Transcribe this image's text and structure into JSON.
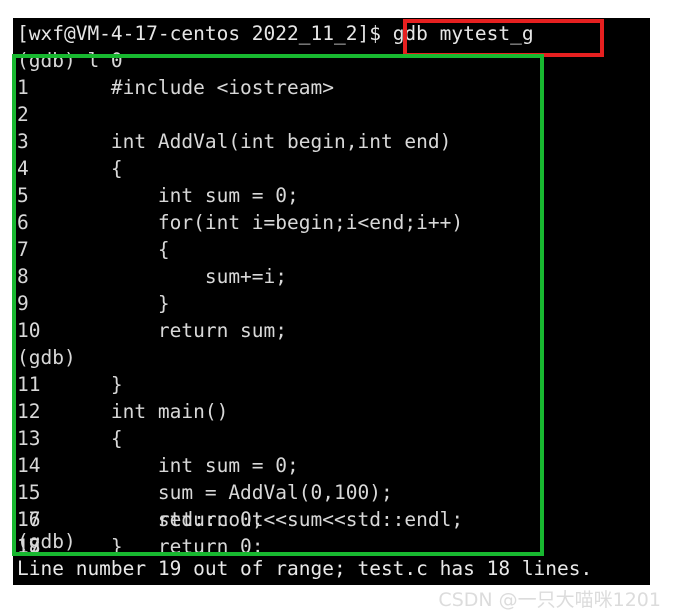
{
  "terminal": {
    "prompt": "[wxf@VM-4-17-centos 2022_11_2]$ ",
    "command": "gdb mytest_g",
    "lines": [
      {
        "kind": "gdb",
        "text": "(gdb) l 0"
      },
      {
        "kind": "code",
        "text": "1\t#include <iostream>"
      },
      {
        "kind": "code",
        "text": "2\t"
      },
      {
        "kind": "code",
        "text": "3\tint AddVal(int begin,int end)"
      },
      {
        "kind": "code",
        "text": "4\t{"
      },
      {
        "kind": "code",
        "text": "5\t    int sum = 0;"
      },
      {
        "kind": "code",
        "text": "6\t    for(int i=begin;i<end;i++)"
      },
      {
        "kind": "code",
        "text": "7\t    {"
      },
      {
        "kind": "code",
        "text": "8\t        sum+=i;"
      },
      {
        "kind": "code",
        "text": "9\t    }"
      },
      {
        "kind": "code",
        "text": "10\t    return sum;"
      },
      {
        "kind": "gdb",
        "text": "(gdb)"
      },
      {
        "kind": "code",
        "text": "11\t}"
      },
      {
        "kind": "code",
        "text": "12\tint main()"
      },
      {
        "kind": "code",
        "text": "13\t{"
      },
      {
        "kind": "code",
        "text": "14\t    int sum = 0;"
      },
      {
        "kind": "code",
        "text": "15\t    sum = AddVal(0,100);"
      },
      {
        "kind": "code",
        "text": "16\t    std::cout<<sum<<std::endl;"
      },
      {
        "kind": "code",
        "text": "17\t    return 0;"
      },
      {
        "kind": "code",
        "text": "18\t}"
      },
      {
        "kind": "gdb",
        "text": "(gdb)"
      },
      {
        "kind": "error",
        "text": "Line number 19 out of range; test.c has 18 lines."
      }
    ]
  },
  "annotations": {
    "command_highlight_color": "#e62020",
    "listing_highlight_color": "#18b830"
  },
  "watermark": {
    "text": "CSDN @一只大喵咪1201"
  }
}
